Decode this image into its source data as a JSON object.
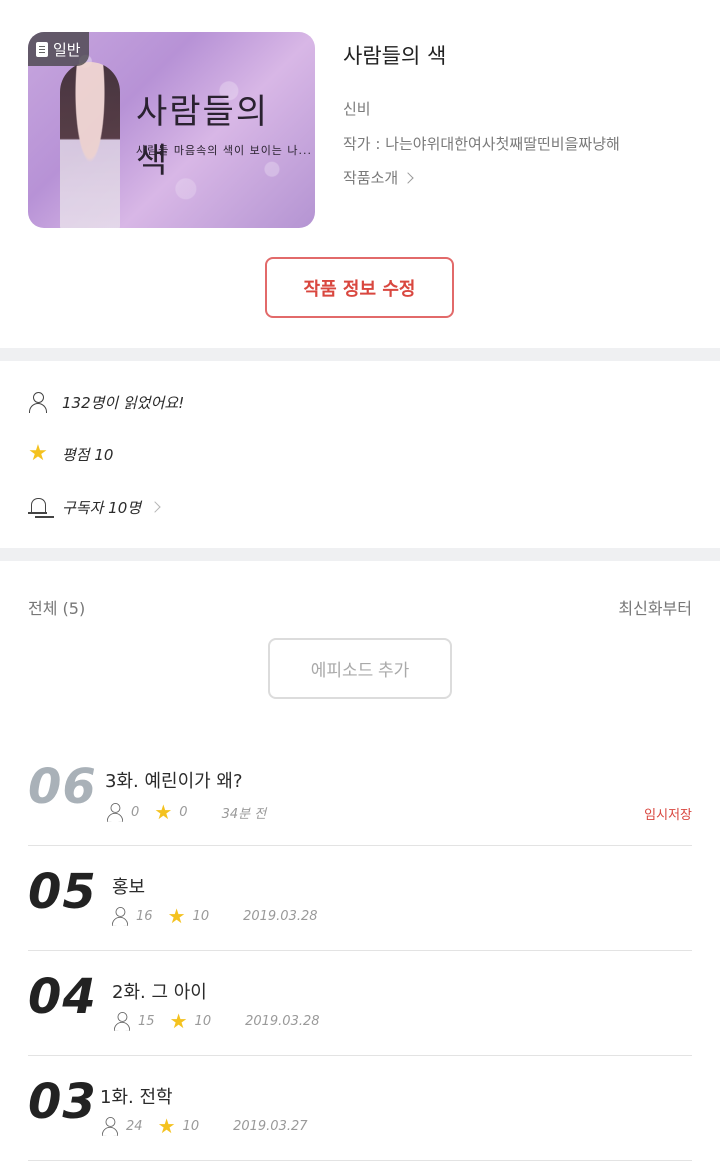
{
  "work": {
    "badge": "일반",
    "cover_title": "사람들의 색",
    "cover_subtitle": "사람들 마음속의 색이 보이는 나...",
    "title": "사람들의 색",
    "genre": "신비",
    "author": "작가 : 나는야위대한여사첫째딸띤비을짜냥해",
    "intro_label": "작품소개",
    "edit_label": "작품 정보 수정"
  },
  "stats": {
    "readers": "132명이 읽었어요!",
    "rating": "평점 10",
    "subscribers": "구독자 10명"
  },
  "episodes_header": {
    "count_label": "전체 (5)",
    "sort_label": "최신화부터",
    "add_label": "에피소드 추가"
  },
  "episodes": [
    {
      "number": "06",
      "title": "3화. 예린이가 왜?",
      "views": "0",
      "rating": "0",
      "date": "34분 전",
      "status": "임시저장"
    },
    {
      "number": "05",
      "title": "홍보",
      "views": "16",
      "rating": "10",
      "date": "2019.03.28",
      "status": ""
    },
    {
      "number": "04",
      "title": "2화. 그 아이",
      "views": "15",
      "rating": "10",
      "date": "2019.03.28",
      "status": ""
    },
    {
      "number": "03",
      "title": "1화. 전학",
      "views": "24",
      "rating": "10",
      "date": "2019.03.27",
      "status": ""
    }
  ],
  "colors": {
    "accent": "#d9473f",
    "star": "#f4c21f",
    "divider": "#eff0f2",
    "draft_number": "#a9b1b8"
  }
}
